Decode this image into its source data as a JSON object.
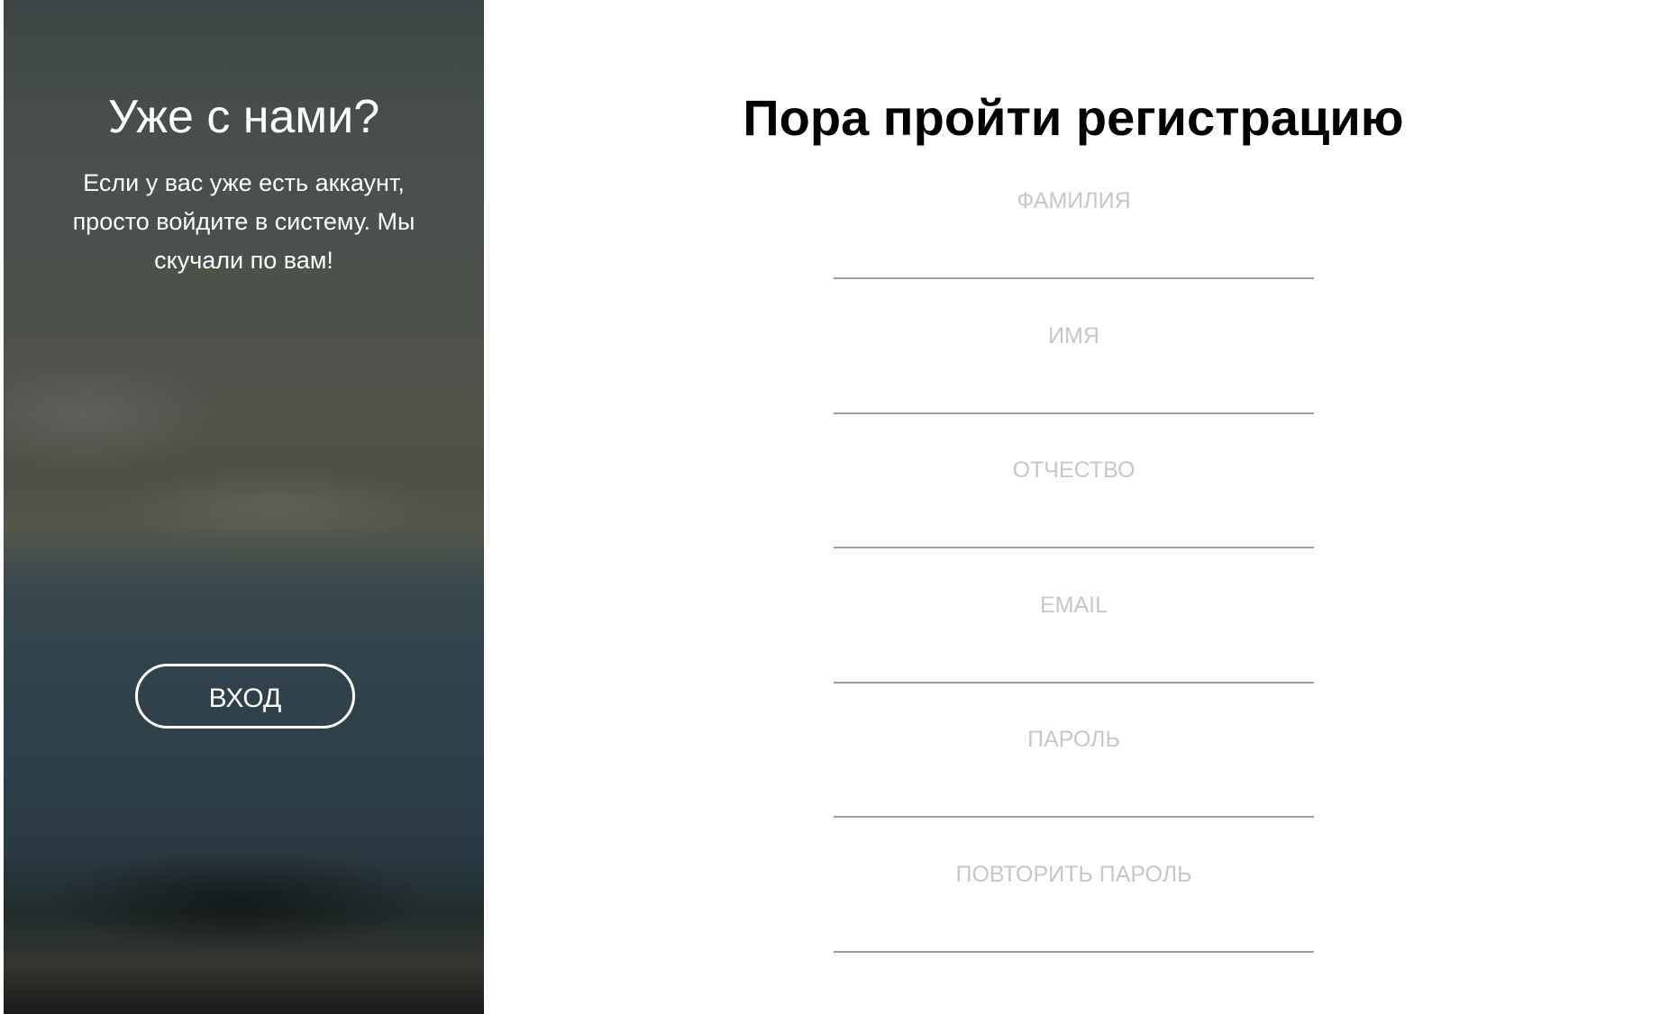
{
  "side_panel": {
    "title": "Уже с нами?",
    "text": "Если у вас уже есть аккаунт, просто войдите в систему. Мы скучали по вам!",
    "login_button": "ВХОД"
  },
  "registration": {
    "title": "Пора пройти регистрацию",
    "fields": [
      {
        "placeholder": "ФАМИЛИЯ",
        "value": ""
      },
      {
        "placeholder": "ИМЯ",
        "value": ""
      },
      {
        "placeholder": "ОТЧЕСТВО",
        "value": ""
      },
      {
        "placeholder": "EMAIL",
        "value": ""
      },
      {
        "placeholder": "ПАРОЛЬ",
        "value": ""
      },
      {
        "placeholder": "ПОВТОРИТЬ ПАРОЛЬ",
        "value": ""
      }
    ]
  }
}
